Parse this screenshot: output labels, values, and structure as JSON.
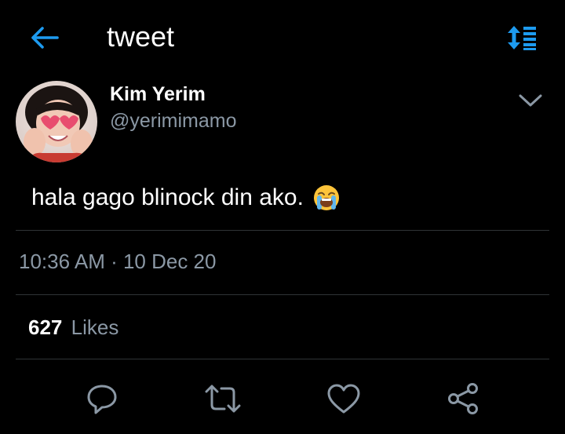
{
  "header": {
    "title": "tweet",
    "back_icon": "arrow-left-icon",
    "sort_icon": "sort-lines-icon",
    "accent_color": "#1d9bf0"
  },
  "tweet": {
    "author": {
      "name": "Kim Yerim",
      "handle": "@yerimimamo",
      "avatar": "profile-photo"
    },
    "text": "hala gago blinock din ako.",
    "emoji": "loudly-crying-face-emoji",
    "timestamp": "10:36 AM · 10 Dec 20",
    "likes": {
      "count": "627",
      "label": "Likes"
    }
  },
  "actions": [
    {
      "name": "reply",
      "icon": "reply-icon"
    },
    {
      "name": "retweet",
      "icon": "retweet-icon"
    },
    {
      "name": "like",
      "icon": "heart-icon"
    },
    {
      "name": "share",
      "icon": "share-icon"
    }
  ],
  "colors": {
    "background": "#000000",
    "text_primary": "#ffffff",
    "text_secondary": "#8b98a5",
    "divider": "#2f3336",
    "accent": "#1d9bf0"
  }
}
